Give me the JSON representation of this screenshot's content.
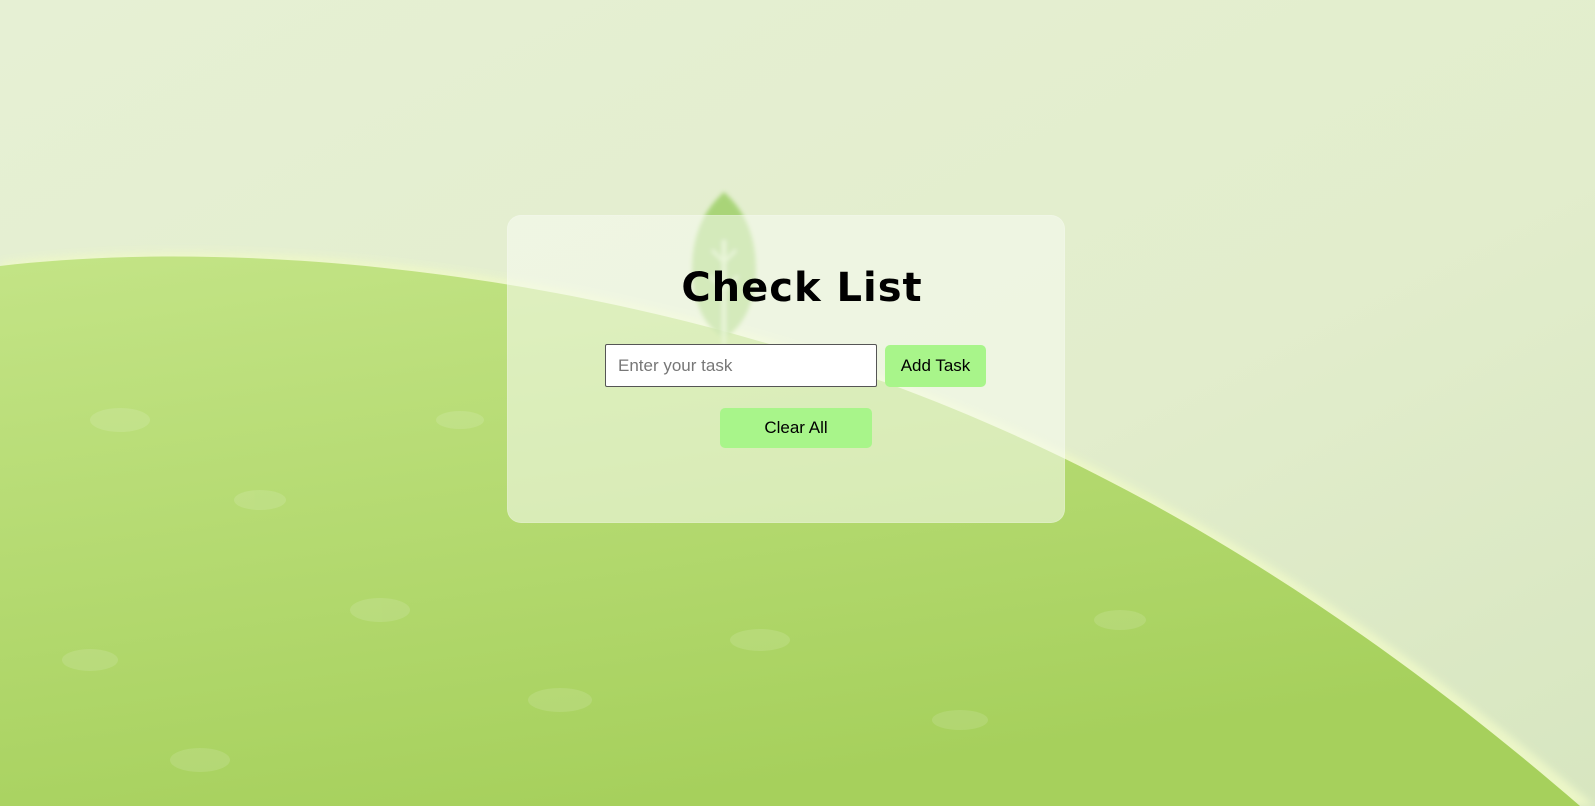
{
  "colors": {
    "background_light": "#e3eed0",
    "background_green": "#b5dd6e",
    "button_green": "#a8f58a"
  },
  "app": {
    "title": "Check List"
  },
  "form": {
    "task_input": {
      "placeholder": "Enter your task",
      "value": ""
    },
    "add_button_label": "Add Task",
    "clear_button_label": "Clear All"
  },
  "decorations": {
    "leaf_icon": "leaf-icon"
  }
}
